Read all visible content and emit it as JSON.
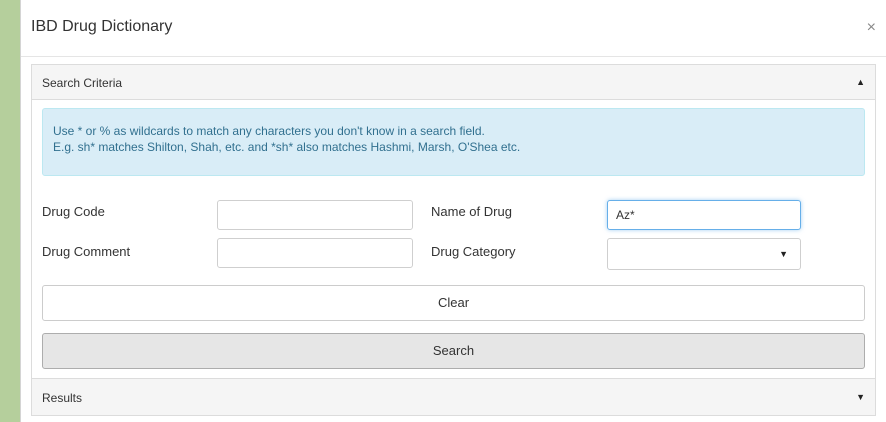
{
  "dialog": {
    "title": "IBD Drug Dictionary",
    "close_glyph": "×"
  },
  "search_panel": {
    "label": "Search Criteria",
    "caret": "▲"
  },
  "info": {
    "line1": "Use * or % as wildcards to match any characters you don't know in a search field.",
    "line2": "E.g. sh* matches Shilton, Shah, etc. and *sh* also matches Hashmi, Marsh, O'Shea etc."
  },
  "fields": {
    "drug_code": {
      "label": "Drug Code",
      "value": ""
    },
    "drug_comment": {
      "label": "Drug Comment",
      "value": ""
    },
    "name_of_drug": {
      "label": "Name of Drug",
      "value": "Az*"
    },
    "drug_category": {
      "label": "Drug Category",
      "value": "",
      "caret": "▼"
    }
  },
  "buttons": {
    "clear": "Clear",
    "search": "Search"
  },
  "results_panel": {
    "label": "Results",
    "caret": "▼"
  },
  "colors": {
    "background": "#b5cf9c",
    "info_bg": "#d9edf7",
    "info_text": "#31708f",
    "focus": "#66afe9"
  }
}
